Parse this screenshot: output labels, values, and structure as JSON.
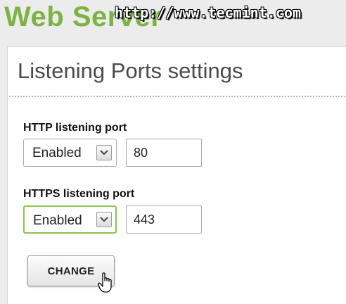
{
  "app": {
    "title": "Web Server",
    "watermark": "http://www.tecmint.com"
  },
  "panel": {
    "title": "Listening Ports settings"
  },
  "http": {
    "label": "HTTP listening port",
    "status": "Enabled",
    "port": "80"
  },
  "https": {
    "label": "HTTPS listening port",
    "status": "Enabled",
    "port": "443"
  },
  "actions": {
    "change_label": "CHANGE"
  },
  "icons": {
    "dropdown": "chevron-down-icon",
    "pointer": "hand-pointer-icon"
  },
  "colors": {
    "brand": "#7cb342",
    "focus_border": "#8bc34a"
  }
}
